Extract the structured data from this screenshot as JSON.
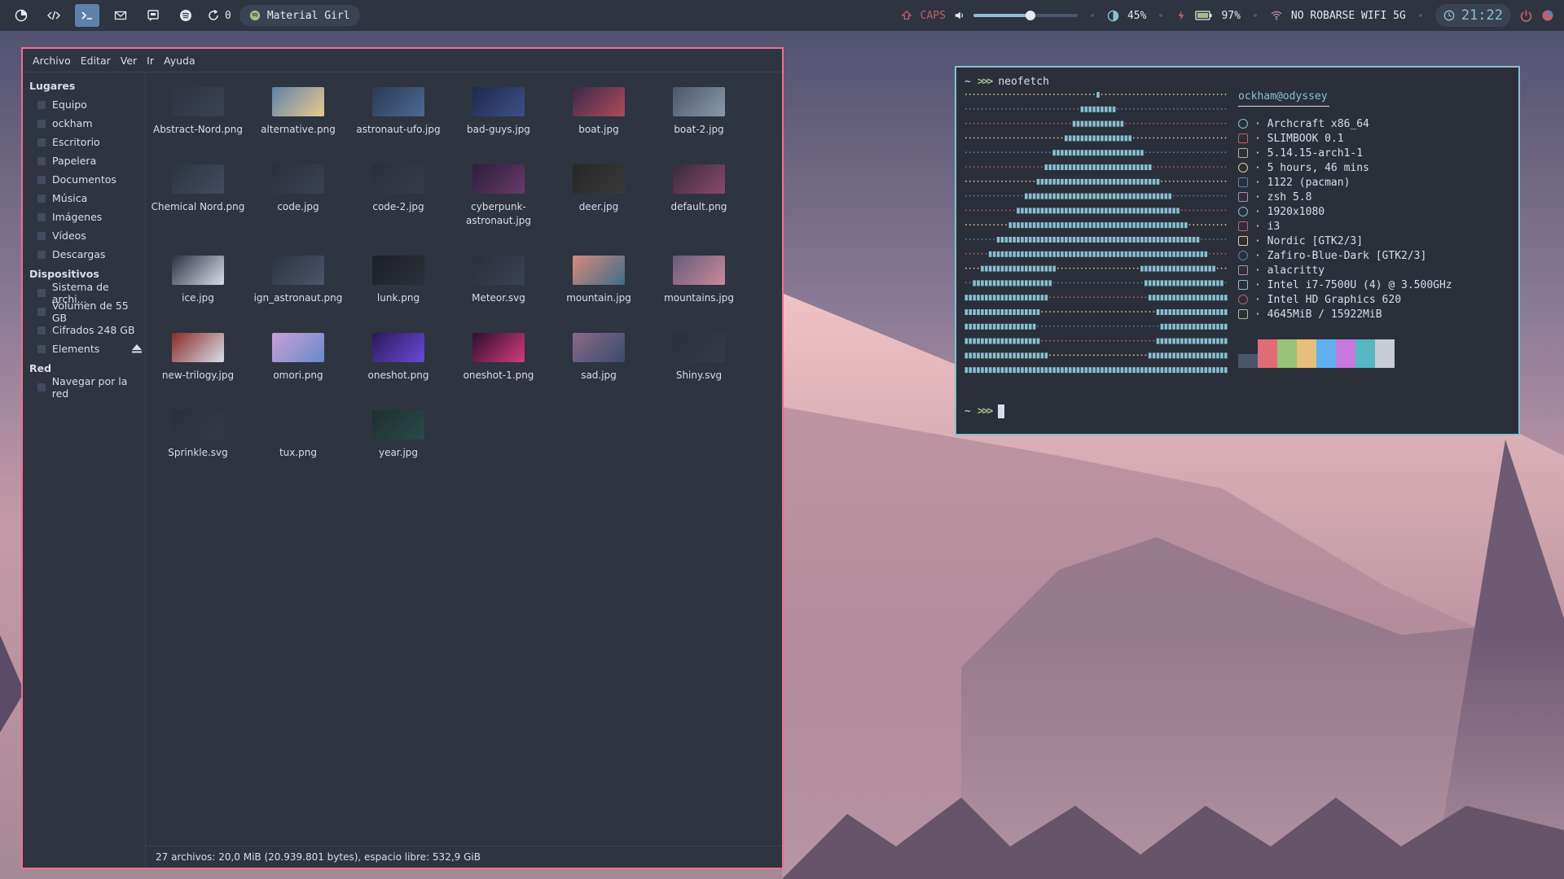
{
  "topbar": {
    "workspace_counter": "0",
    "music_title": "Material Girl",
    "caps_label": "CAPS",
    "volume_level": 0.55,
    "brightness": "45%",
    "battery": "97%",
    "wifi_name": "NO ROBARSE WIFI 5G",
    "clock": "21:22",
    "icons": [
      "arch-logo-icon",
      "code-icon",
      "terminal-icon",
      "mail-icon",
      "chat-icon",
      "spotify-icon",
      "refresh-icon",
      "caps-arrow-icon",
      "volume-icon",
      "brightness-icon",
      "battery-charging-icon",
      "wifi-icon",
      "clock-icon",
      "power-icon",
      "status-dot-icon"
    ]
  },
  "file_manager": {
    "menu": [
      "Archivo",
      "Editar",
      "Ver",
      "Ir",
      "Ayuda"
    ],
    "sections": [
      {
        "heading": "Lugares",
        "items": [
          "Equipo",
          "ockham",
          "Escritorio",
          "Papelera",
          "Documentos",
          "Música",
          "Imágenes",
          "Vídeos",
          "Descargas"
        ]
      },
      {
        "heading": "Dispositivos",
        "items": [
          "Sistema de archi...",
          "Volumen de 55 GB",
          "Cifrados 248 GB",
          "Elements"
        ]
      },
      {
        "heading": "Red",
        "items": [
          "Navegar por la red"
        ]
      }
    ],
    "files": [
      {
        "name": "Abstract-Nord.png",
        "c1": "#2e3440",
        "c2": "#3b4252"
      },
      {
        "name": "alternative.png",
        "c1": "#5e81ac",
        "c2": "#ebcb8b"
      },
      {
        "name": "astronaut-ufo.jpg",
        "c1": "#2b3a55",
        "c2": "#4c6a92"
      },
      {
        "name": "bad-guys.jpg",
        "c1": "#1f2a4a",
        "c2": "#3d4f8a"
      },
      {
        "name": "boat.jpg",
        "c1": "#3a2a4a",
        "c2": "#b04a5a"
      },
      {
        "name": "boat-2.jpg",
        "c1": "#4c566a",
        "c2": "#8a9aa8"
      },
      {
        "name": "Chemical Nord.png",
        "c1": "#2e3440",
        "c2": "#434c5e"
      },
      {
        "name": "code.jpg",
        "c1": "#2b303b",
        "c2": "#3b4252"
      },
      {
        "name": "code-2.jpg",
        "c1": "#2b303b",
        "c2": "#363d4a"
      },
      {
        "name": "cyberpunk-astronaut.jpg",
        "c1": "#2a1f3a",
        "c2": "#6a3a6a"
      },
      {
        "name": "deer.jpg",
        "c1": "#262626",
        "c2": "#3a3a3a"
      },
      {
        "name": "default.png",
        "c1": "#3a2a3a",
        "c2": "#8a4a6a"
      },
      {
        "name": "ice.jpg",
        "c1": "#2b3140",
        "c2": "#d8dee9"
      },
      {
        "name": "ign_astronaut.png",
        "c1": "#2e3440",
        "c2": "#4c566a"
      },
      {
        "name": "lunk.png",
        "c1": "#1c1f26",
        "c2": "#2b2f38"
      },
      {
        "name": "Meteor.svg",
        "c1": "#2b303b",
        "c2": "#3b4252"
      },
      {
        "name": "mountain.jpg",
        "c1": "#d88a7a",
        "c2": "#3b6e8a"
      },
      {
        "name": "mountains.jpg",
        "c1": "#6a5a7a",
        "c2": "#c88a9a"
      },
      {
        "name": "new-trilogy.jpg",
        "c1": "#8a2a2a",
        "c2": "#d8dee9"
      },
      {
        "name": "omori.png",
        "c1": "#c8a0d8",
        "c2": "#6a8ac8"
      },
      {
        "name": "oneshot.png",
        "c1": "#2a1a5a",
        "c2": "#6a4ad8"
      },
      {
        "name": "oneshot-1.png",
        "c1": "#2a1030",
        "c2": "#d83a7a"
      },
      {
        "name": "sad.jpg",
        "c1": "#8a6a8a",
        "c2": "#3a4a6a"
      },
      {
        "name": "Shiny.svg",
        "c1": "#2b303b",
        "c2": "#353b48"
      },
      {
        "name": "Sprinkle.svg",
        "c1": "#2b303b",
        "c2": "#343a47"
      },
      {
        "name": "tux.png",
        "c1": "#2e3440",
        "c2": "#2e3440"
      },
      {
        "name": "year.jpg",
        "c1": "#1f2f30",
        "c2": "#2a4a4a"
      }
    ],
    "status": "27 archivos: 20,0 MiB (20.939.801 bytes), espacio libre: 532,9 GiB"
  },
  "terminal": {
    "prompt_tilde": "~",
    "prompt_arrows": ">>>",
    "command": "neofetch",
    "user_host": "ockham@odyssey",
    "info": [
      {
        "icon": "command-key-icon",
        "color": "#88c0d0",
        "text": "Archcraft x86_64"
      },
      {
        "icon": "monitor-icon",
        "color": "#bf616a",
        "text": "SLIMBOOK 0.1"
      },
      {
        "icon": "gear-icon",
        "color": "#a3be8c",
        "text": "5.14.15-arch1-1"
      },
      {
        "icon": "clock-icon",
        "color": "#ebcb8b",
        "text": "5 hours, 46 mins"
      },
      {
        "icon": "package-icon",
        "color": "#5e81ac",
        "text": "1122 (pacman)"
      },
      {
        "icon": "dollar-icon",
        "color": "#b48ead",
        "text": "zsh 5.8"
      },
      {
        "icon": "image-icon",
        "color": "#88c0d0",
        "text": "1920x1080"
      },
      {
        "icon": "window-icon",
        "color": "#bf616a",
        "text": "i3"
      },
      {
        "icon": "hexagon-icon",
        "color": "#ebcb8b",
        "text": "Nordic [GTK2/3]"
      },
      {
        "icon": "copy-icon",
        "color": "#5e81ac",
        "text": "Zafiro-Blue-Dark [GTK2/3]"
      },
      {
        "icon": "prompt-icon",
        "color": "#b48ead",
        "text": "alacritty"
      },
      {
        "icon": "cpu-icon",
        "color": "#88c0d0",
        "text": "Intel i7-7500U (4) @ 3.500GHz"
      },
      {
        "icon": "star-icon",
        "color": "#bf616a",
        "text": "Intel HD Graphics 620"
      },
      {
        "icon": "pie-icon",
        "color": "#a3be8c",
        "text": "4645MiB / 15922MiB"
      }
    ],
    "palette": [
      "#4c566a",
      "#e06c75",
      "#98c379",
      "#e5c07b",
      "#61afef",
      "#c678dd",
      "#56b6c2",
      "#c8ccd4"
    ]
  }
}
